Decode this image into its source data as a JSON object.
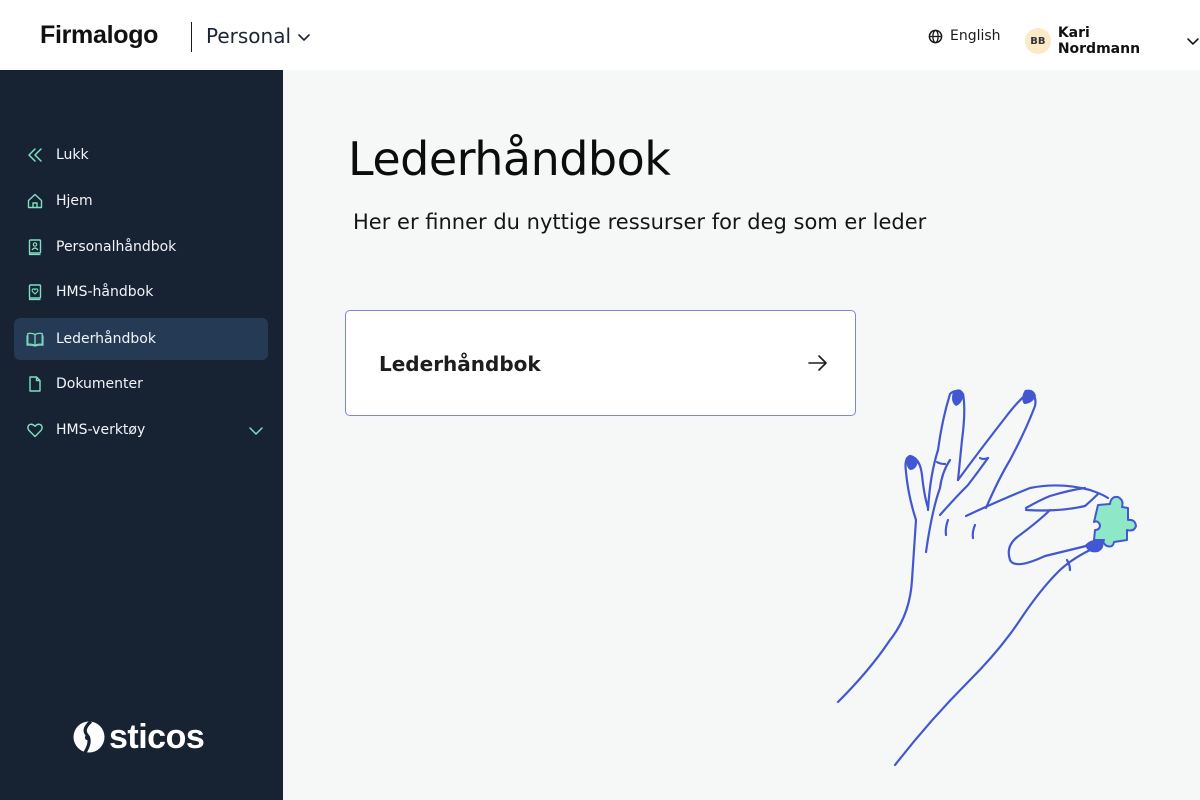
{
  "header": {
    "brand": "Firmalogo",
    "workspace_label": "Personal",
    "language_label": "English",
    "user": {
      "initials": "BB",
      "name": "Kari Nordmann"
    }
  },
  "sidebar": {
    "items": [
      {
        "label": "Lukk",
        "icon": "double-chevron-left-icon"
      },
      {
        "label": "Hjem",
        "icon": "home-icon"
      },
      {
        "label": "Personalhåndbok",
        "icon": "person-book-icon"
      },
      {
        "label": "HMS-håndbok",
        "icon": "heart-book-icon"
      },
      {
        "label": "Lederhåndbok",
        "icon": "open-book-icon",
        "active": true
      },
      {
        "label": "Dokumenter",
        "icon": "document-icon"
      },
      {
        "label": "HMS-verktøy",
        "icon": "heart-icon",
        "expandable": true
      }
    ],
    "footer_logo": "sticos"
  },
  "main": {
    "title": "Lederhåndbok",
    "subtitle": "Her er finner du nyttige ressurser for deg som er leder",
    "cards": [
      {
        "label": "Lederhåndbok",
        "icon": "arrow-right-icon"
      }
    ]
  },
  "colors": {
    "sidebar_bg": "#172233",
    "sidebar_active_bg": "#243a55",
    "icon_accent": "#7fe0c0",
    "card_border": "#7f86d6",
    "illustration_stroke": "#4257d1",
    "puzzle_fill": "#8ee8c8",
    "avatar_bg": "#fbeac8"
  }
}
